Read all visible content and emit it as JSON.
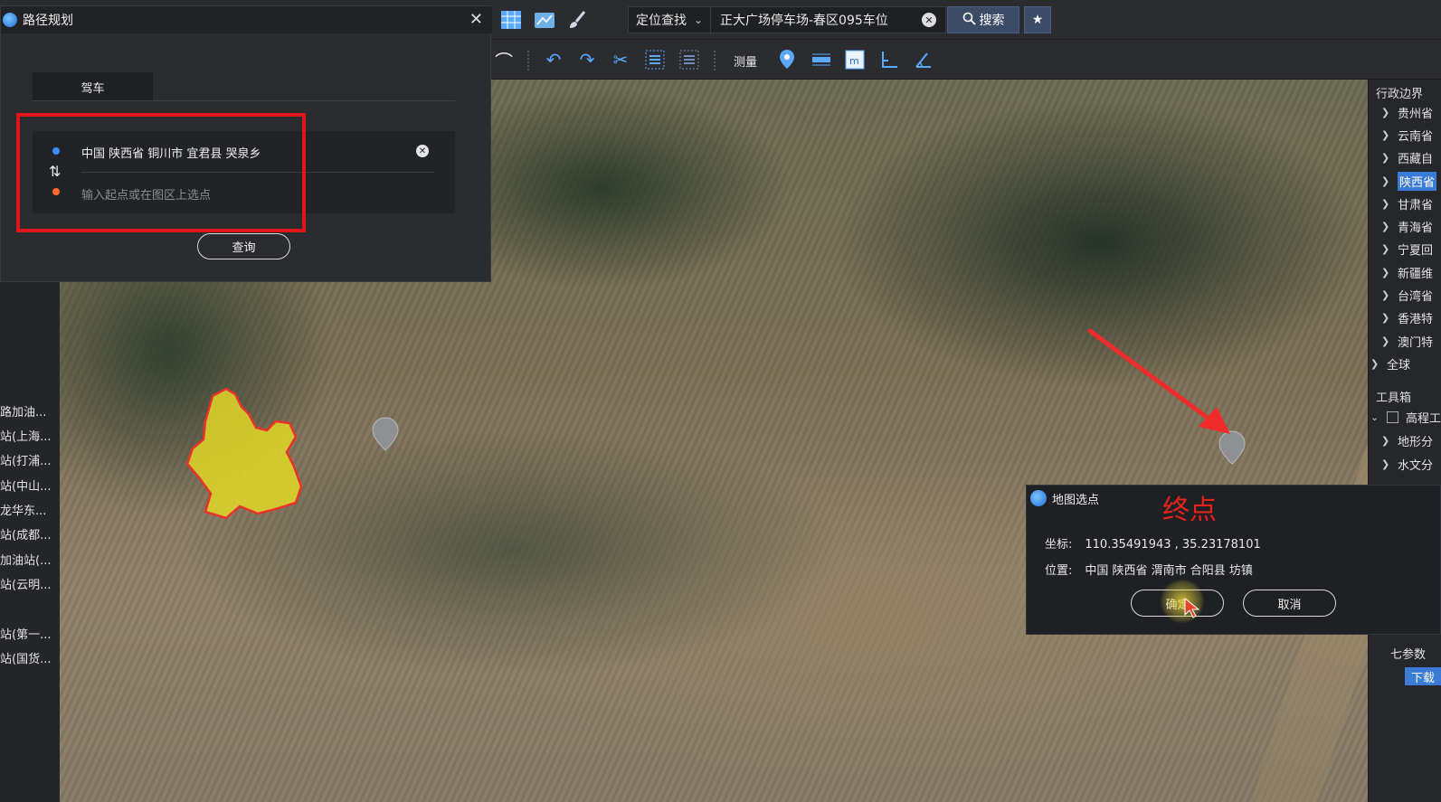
{
  "toolbar": {
    "locate_mode": "定位查找",
    "search_value": "正大广场停车场-春区095车位",
    "search_button": "搜索",
    "measure_label": "测量"
  },
  "route_dialog": {
    "title": "路径规划",
    "tab_drive": "驾车",
    "start_value": "中国 陕西省 铜川市 宜君县 哭泉乡",
    "end_placeholder": "输入起点或在图区上选点",
    "query_button": "查询"
  },
  "left_list": {
    "items": [
      "路加油...",
      "站(上海...",
      "站(打浦...",
      "站(中山...",
      "龙华东...",
      "站(成都...",
      "加油站(...",
      "站(云明...",
      "站(第一...",
      "站(国货..."
    ]
  },
  "right_panel": {
    "admin_title": "行政边界",
    "regions": [
      "贵州省",
      "云南省",
      "西藏自",
      "陕西省",
      "甘肃省",
      "青海省",
      "宁夏回",
      "新疆维",
      "台湾省",
      "香港特",
      "澳门特"
    ],
    "global": "全球",
    "toolbox_title": "工具箱",
    "toolbox_items": [
      "高程工",
      "地形分",
      "水文分"
    ],
    "seven_param": "七参数",
    "download": "下载"
  },
  "pick_dialog": {
    "title": "地图选点",
    "annotation": "终点",
    "coord_label": "坐标:",
    "coord_value": "110.35491943 , 35.23178101",
    "position_label": "位置:",
    "position_value": "中国 陕西省 渭南市 合阳县 坊镇",
    "confirm_button": "确定",
    "cancel_button": "取消"
  },
  "colors": {
    "accent_blue": "#3a7bd5",
    "annotation_red": "#e0151b",
    "highlight_yellow": "#e6e02a"
  }
}
